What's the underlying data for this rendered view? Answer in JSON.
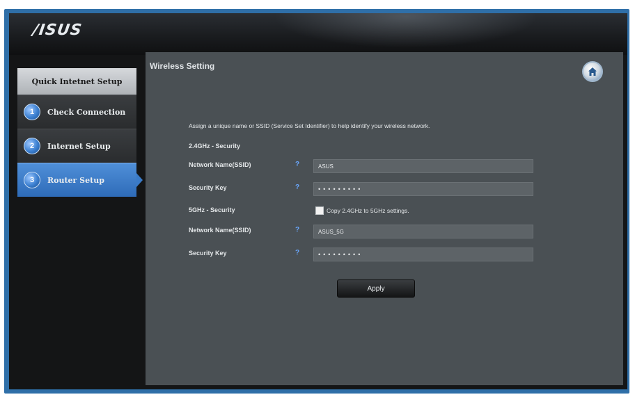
{
  "brand": {
    "logo_text": "/ISUS"
  },
  "sidebar": {
    "header": "Quick Intetnet Setup",
    "items": [
      {
        "number": "1",
        "label": "Check Connection",
        "active": false
      },
      {
        "number": "2",
        "label": "Internet Setup",
        "active": false
      },
      {
        "number": "3",
        "label": "Router Setup",
        "active": true
      }
    ]
  },
  "panel": {
    "title": "Wireless Setting",
    "intro": "Assign a unique name or SSID (Service Set Identifier) to help identify your wireless network.",
    "help_glyph": "?",
    "band24": {
      "section_label": "2.4GHz - Security",
      "ssid_label": "Network Name(SSID)",
      "ssid_value": "ASUS",
      "key_label": "Security Key",
      "key_value": "•••••••••"
    },
    "band5": {
      "section_label": "5GHz - Security",
      "copy_label": "Copy 2.4GHz to 5GHz settings.",
      "copy_checked": false,
      "ssid_label": "Network Name(SSID)",
      "ssid_value": "ASUS_5G",
      "key_label": "Security Key",
      "key_value": "•••••••••"
    },
    "apply_label": "Apply"
  },
  "icons": {
    "home": "home-icon"
  },
  "colors": {
    "accent": "#3a7bc8",
    "panel_bg": "#4a5054",
    "help": "#6aa8ff"
  }
}
